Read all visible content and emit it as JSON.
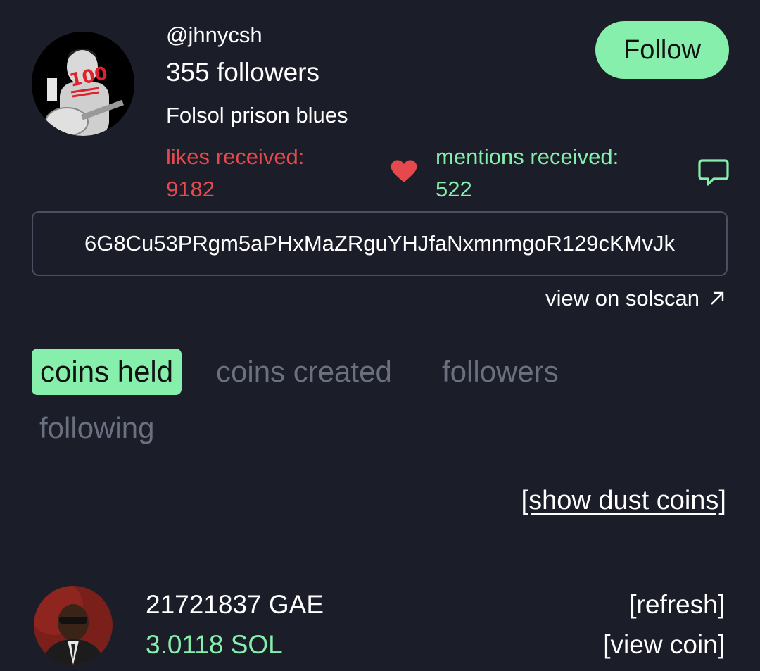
{
  "profile": {
    "username": "@jhnycsh",
    "followers": "355 followers",
    "bio": "Folsol prison blues",
    "follow_label": "Follow",
    "likes_label": "likes received:",
    "likes_value": "9182",
    "mentions_label": "mentions received:",
    "mentions_value": "522",
    "address": "6G8Cu53PRgm5aPHxMaZRguYHJfaNxmnmgoR129cKMvJk",
    "solscan_label": "view on solscan",
    "avatar_icon": "avatar-image"
  },
  "tabs": [
    {
      "label": "coins held",
      "active": true
    },
    {
      "label": "coins created",
      "active": false
    },
    {
      "label": "followers",
      "active": false
    },
    {
      "label": "following",
      "active": false
    }
  ],
  "dust_label": "[show dust coins]",
  "coins": [
    {
      "amount": "21721837 GAE",
      "sol": "3.0118 SOL",
      "refresh_label": "[refresh]",
      "view_label": "[view coin]"
    }
  ],
  "colors": {
    "background": "#1b1d28",
    "accent_green": "#86efac",
    "likes_red": "#e5484d",
    "muted_tab": "#6b7080",
    "border": "#4a5062"
  },
  "icons": {
    "heart": "heart-icon",
    "chat": "chat-bubble-icon",
    "external": "arrow-up-right-icon"
  }
}
